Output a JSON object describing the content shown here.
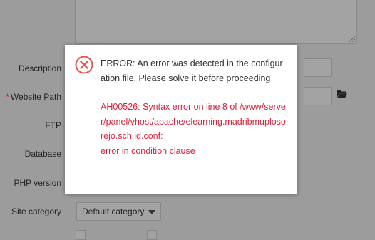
{
  "form": {
    "labels": {
      "description": "Description",
      "website_path": "Website Path",
      "ftp": "FTP",
      "database": "Database",
      "php_version": "PHP version",
      "site_category": "Site category"
    },
    "required_marker": "*",
    "site_category_value": "Default category"
  },
  "dialog": {
    "icon": "error-circle-x-icon",
    "message": "ERROR: An error was detected in the configuration file. Please solve it before proceeding",
    "detail_line1": "AH00526: Syntax error on line 8 of /www/server/panel/vhost/apache/elearning.madribmuplosorejo.sch.id.conf:",
    "detail_line2": "error in condition clause"
  },
  "colors": {
    "overlay_bg": "#9c9c9c",
    "error_red": "#e0203a",
    "icon_red": "#e8534f"
  }
}
